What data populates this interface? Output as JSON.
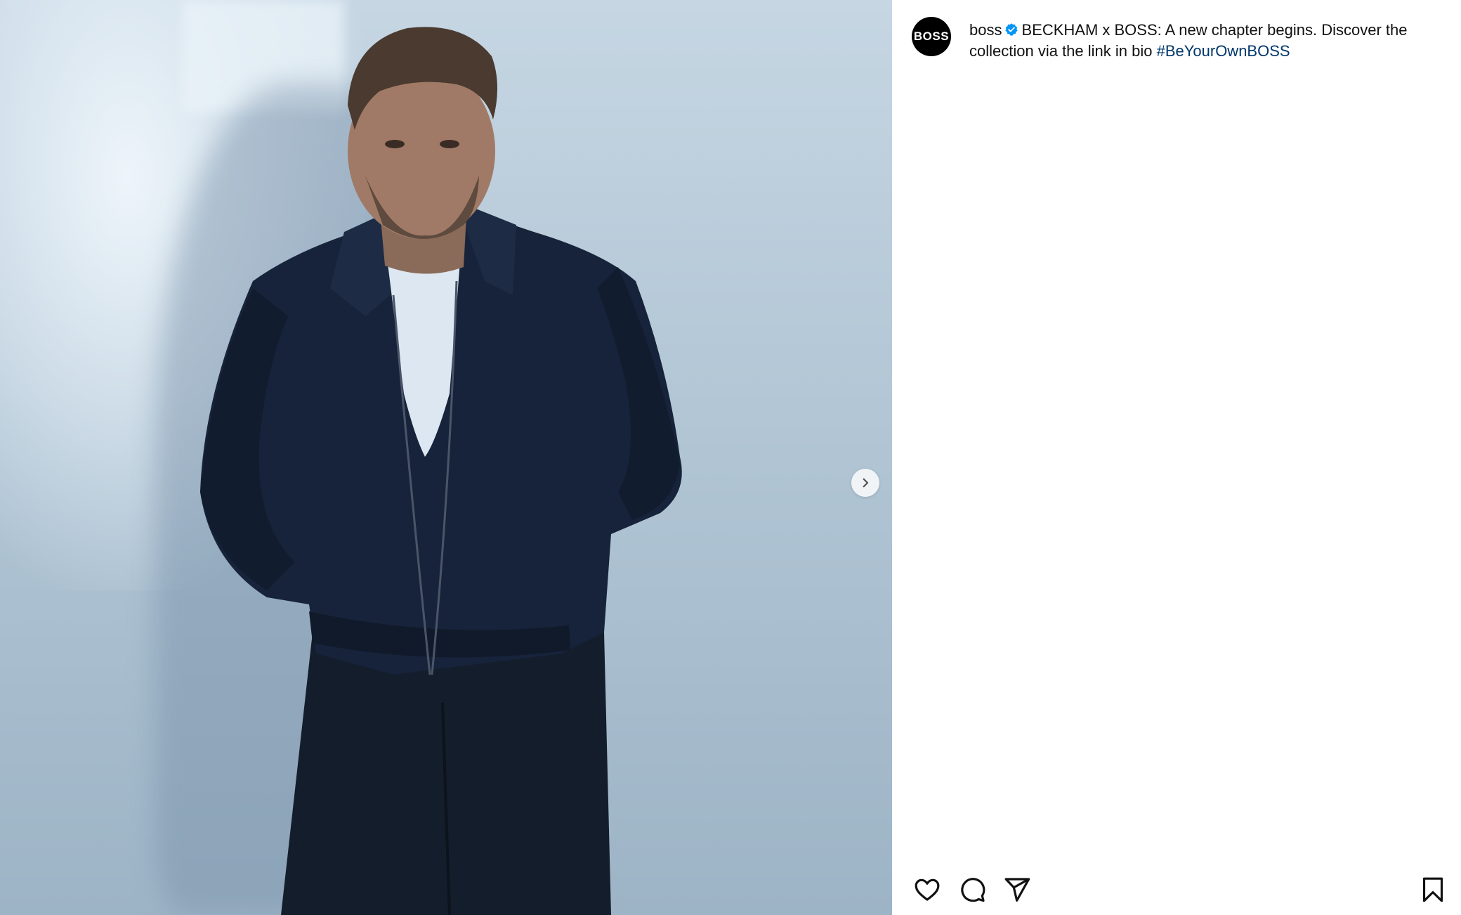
{
  "post": {
    "username": "boss",
    "avatar_text": "BOSS",
    "caption_text": "BECKHAM x BOSS: A new chapter begins. Discover the collection via the link in bio ",
    "hashtag": "#BeYourOwnBOSS"
  },
  "icons": {
    "verified": "verified-badge-icon",
    "next": "chevron-right-icon",
    "like": "heart-icon",
    "comment": "comment-icon",
    "share": "paper-plane-icon",
    "save": "bookmark-icon"
  },
  "colors": {
    "hashtag": "#00376b",
    "verified": "#0095f6",
    "text": "#111111",
    "background": "#ffffff"
  }
}
